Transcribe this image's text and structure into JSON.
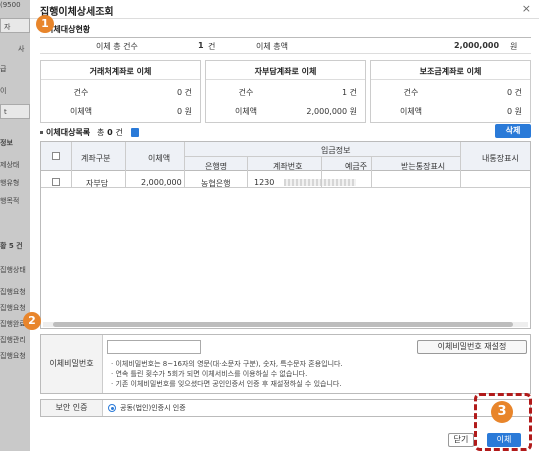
{
  "background": {
    "items": [
      "(9500",
      "자",
      "사",
      "급",
      "이",
      "t",
      "정보",
      "제상태",
      "행유형",
      "행목적",
      "황 5 건",
      "집행상태",
      "집행요청",
      "집행요청",
      "집행완료",
      "집행관리",
      "집행요청"
    ]
  },
  "modal": {
    "title": "집행이체상세조회",
    "close_icon": "×"
  },
  "summary": {
    "section_title": "이체대상현황",
    "count_label": "이체 총 건수",
    "count_value": "1",
    "count_unit": "건",
    "amount_label": "이체 총액",
    "amount_value": "2,000,000",
    "amount_unit": "원"
  },
  "cards": [
    {
      "title": "거래처계좌로 이체",
      "count_label": "건수",
      "count_value": "0 건",
      "amount_label": "이체액",
      "amount_value": "0 원"
    },
    {
      "title": "자부담계좌로 이체",
      "count_label": "건수",
      "count_value": "1 건",
      "amount_label": "이체액",
      "amount_value": "2,000,000 원"
    },
    {
      "title": "보조금계좌로 이체",
      "count_label": "건수",
      "count_value": "0 건",
      "amount_label": "이체액",
      "amount_value": "0 원"
    }
  ],
  "list": {
    "section_title": "이체대상목록",
    "total_prefix": "총",
    "total_value": "0",
    "total_unit": "건",
    "delete_label": "삭제",
    "headers": {
      "account_type": "계좌구분",
      "amount": "이체액",
      "deposit_info": "입금정보",
      "bank": "은행명",
      "account_no": "계좌번호",
      "holder": "예금주",
      "receiver_memo": "받는통장표시",
      "my_memo": "내통장표시"
    },
    "rows": [
      {
        "account_type": "자부담",
        "amount": "2,000,000",
        "bank": "농협은행",
        "account_no": "1230",
        "holder": "",
        "receiver_memo": "",
        "my_memo": ""
      }
    ]
  },
  "password": {
    "label": "이체비밀번호",
    "reset_label": "이체비밀번호 재설정",
    "notes": [
      "· 이체비밀번호는 8~16자의 영문(대·소문자 구분), 숫자, 특수문자 혼용입니다.",
      "· 연속 틀린 횟수가 5회가 되면 이체서비스를 이용하실 수 없습니다.",
      "· 기존 이체비밀번호를 잊으셨다면 공인인증서 인증 후 재설정하실 수 있습니다."
    ]
  },
  "security": {
    "label": "보안 인증",
    "option_label": "공동(법인)인증시 인증"
  },
  "footer": {
    "close_label": "닫기",
    "transfer_label": "이체"
  },
  "markers": [
    "1",
    "2",
    "3"
  ],
  "colors": {
    "accent": "#2a7ad8",
    "marker": "#e8852b",
    "highlight": "#b11a1a"
  }
}
